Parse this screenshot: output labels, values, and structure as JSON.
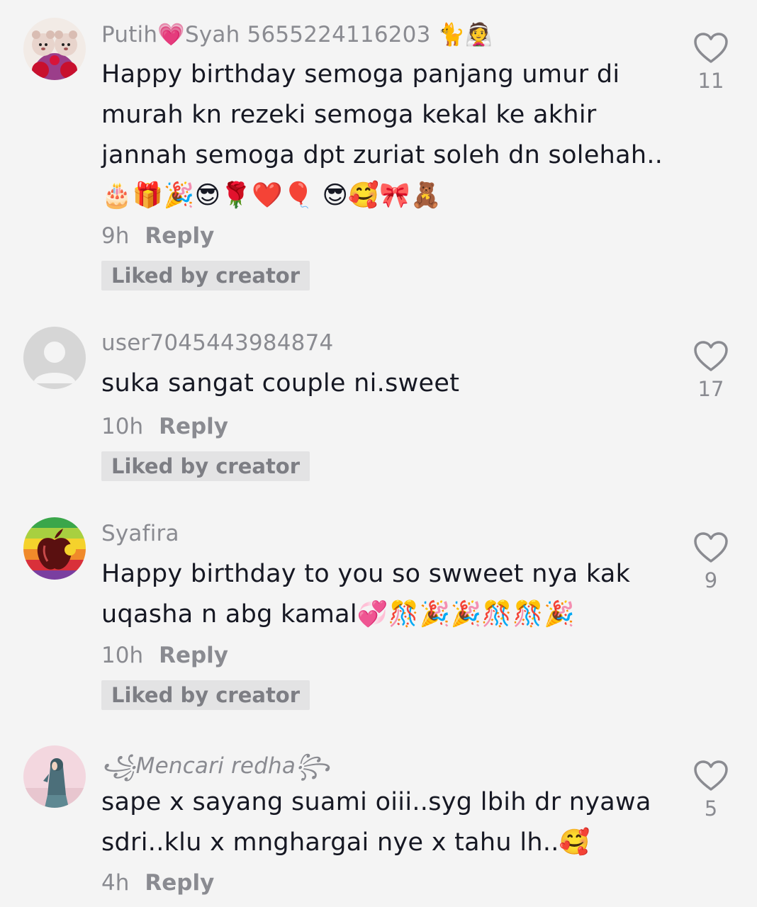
{
  "comments": [
    {
      "username": "Putih💗Syah 5655224116203 🐈👰",
      "text": "Happy birthday semoga panjang umur di murah kn rezeki semoga kekal ke akhir jannah semoga dpt zuriat soleh dn solehah.. 🎂🎁🎉😎🌹❤️🎈 😎🥰🎀🧸",
      "time": "9h",
      "reply_label": "Reply",
      "liked_label": "Liked by creator",
      "likes": "11",
      "avatar_icon": "teddy-bears-avatar"
    },
    {
      "username": "user7045443984874",
      "text": "suka sangat couple ni.sweet",
      "time": "10h",
      "reply_label": "Reply",
      "liked_label": "Liked by creator",
      "likes": "17",
      "avatar_icon": "default-user-avatar"
    },
    {
      "username": "Syafira",
      "text": "Happy birthday to you so swweet nya kak uqasha n abg kamal💞🎊🎉🎉🎊🎊🎉",
      "time": "10h",
      "reply_label": "Reply",
      "liked_label": "Liked by creator",
      "likes": "9",
      "avatar_icon": "rainbow-apple-avatar"
    },
    {
      "username": "꧁Mencari redha꧂",
      "text": "sape x sayang suami oiii..syg lbih dr nyawa sdri..klu x mnghargai nye x tahu lh..🥰",
      "time": "4h",
      "reply_label": "Reply",
      "likes": "5",
      "avatar_icon": "hijab-girl-avatar"
    }
  ],
  "colors": {
    "background": "#f4f4f4",
    "text": "#161823",
    "secondary": "#8a8b91",
    "badge_bg": "#e3e3e4"
  }
}
